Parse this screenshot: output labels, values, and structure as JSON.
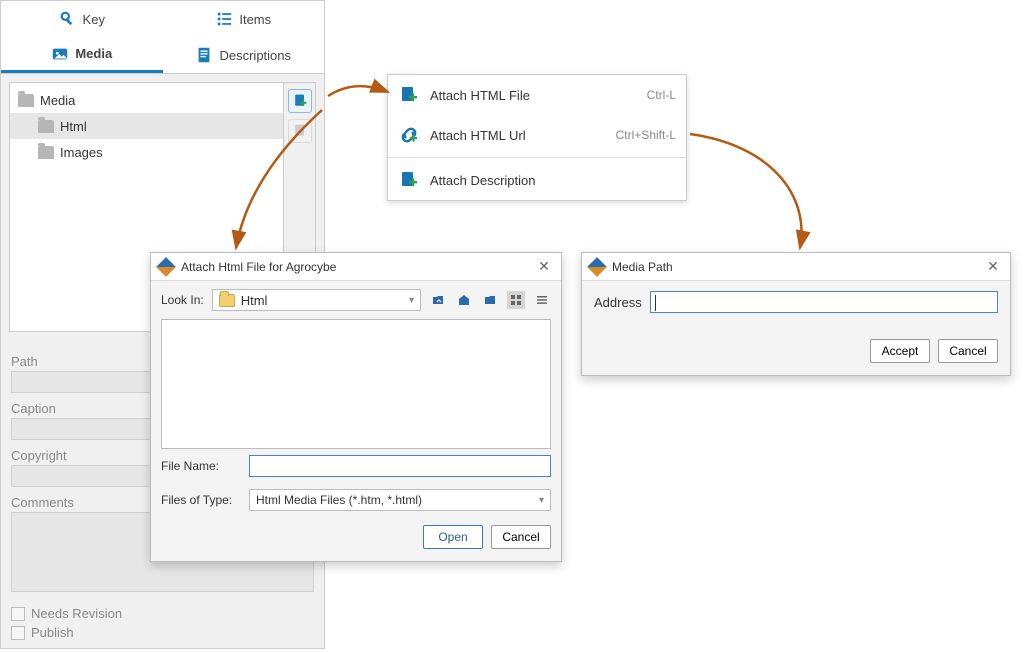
{
  "tabs": {
    "key": "Key",
    "items": "Items",
    "media": "Media",
    "descriptions": "Descriptions"
  },
  "tree": {
    "root": "Media",
    "html": "Html",
    "images": "Images"
  },
  "form": {
    "path": "Path",
    "caption": "Caption",
    "copyright": "Copyright",
    "comments": "Comments"
  },
  "checks": {
    "needs_revision": "Needs Revision",
    "publish": "Publish"
  },
  "ctx": {
    "attach_file": "Attach HTML File",
    "attach_file_short": "Ctrl-L",
    "attach_url": "Attach HTML Url",
    "attach_url_short": "Ctrl+Shift-L",
    "attach_desc": "Attach Description"
  },
  "file_dialog": {
    "title": "Attach Html File for Agrocybe",
    "look_in": "Look In:",
    "look_in_value": "Html",
    "file_name": "File Name:",
    "files_of_type": "Files of Type:",
    "type_value": "Html Media Files (*.htm, *.html)",
    "open": "Open",
    "cancel": "Cancel"
  },
  "path_dialog": {
    "title": "Media Path",
    "address": "Address",
    "accept": "Accept",
    "cancel": "Cancel"
  }
}
